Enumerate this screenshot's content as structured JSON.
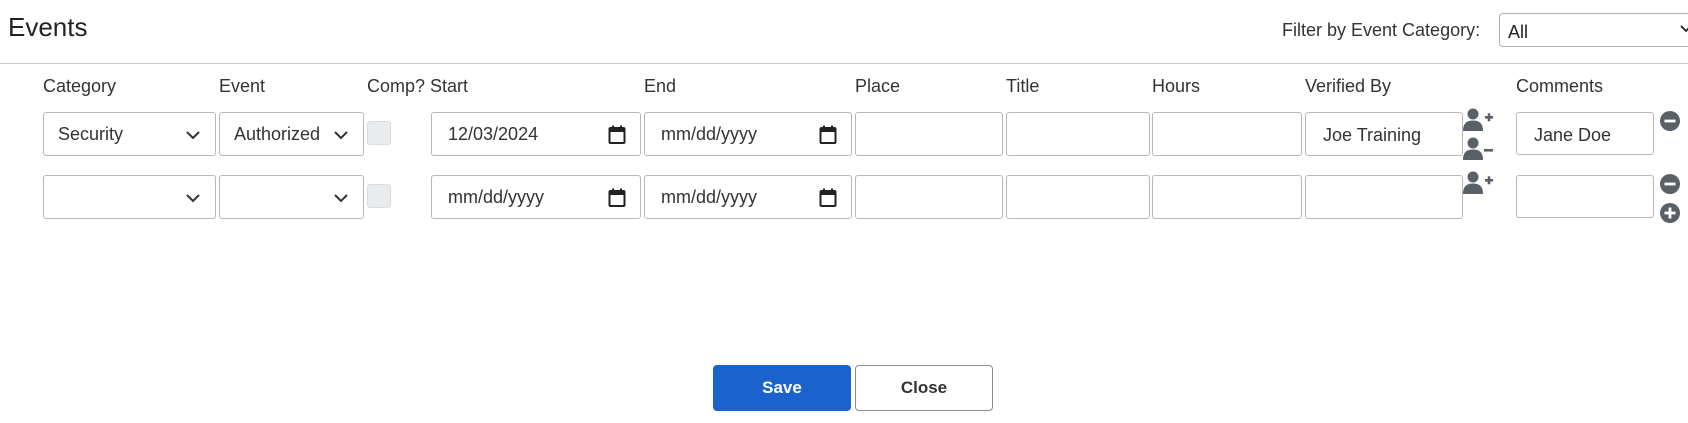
{
  "page": {
    "title": "Events",
    "filter_label": "Filter by Event Category:",
    "filter_value": "All"
  },
  "columns": {
    "category": "Category",
    "event": "Event",
    "comp": "Comp?",
    "start": "Start",
    "end": "End",
    "place": "Place",
    "title": "Title",
    "hours": "Hours",
    "verified_by": "Verified By",
    "comments": "Comments"
  },
  "rows": [
    {
      "category": "Security",
      "event": "Authorized",
      "start": "12/03/2024",
      "end": "mm/dd/yyyy",
      "place": "",
      "title": "",
      "hours": "",
      "verified_by": "Joe Training",
      "comments": "Jane Doe"
    },
    {
      "category": "",
      "event": "",
      "start": "mm/dd/yyyy",
      "end": "mm/dd/yyyy",
      "place": "",
      "title": "",
      "hours": "",
      "verified_by": "",
      "comments": ""
    }
  ],
  "buttons": {
    "save": "Save",
    "close": "Close"
  },
  "icons": {
    "add_user": "user-plus-icon",
    "remove_user": "user-minus-icon",
    "remove_row": "minus-circle-icon",
    "add_row": "plus-circle-icon",
    "dropdown": "chevron-down-icon",
    "calendar": "calendar-icon"
  },
  "colors": {
    "primary": "#1a63cc",
    "icon": "#5a6068",
    "checkbox_disabled": "#e9ecef"
  }
}
